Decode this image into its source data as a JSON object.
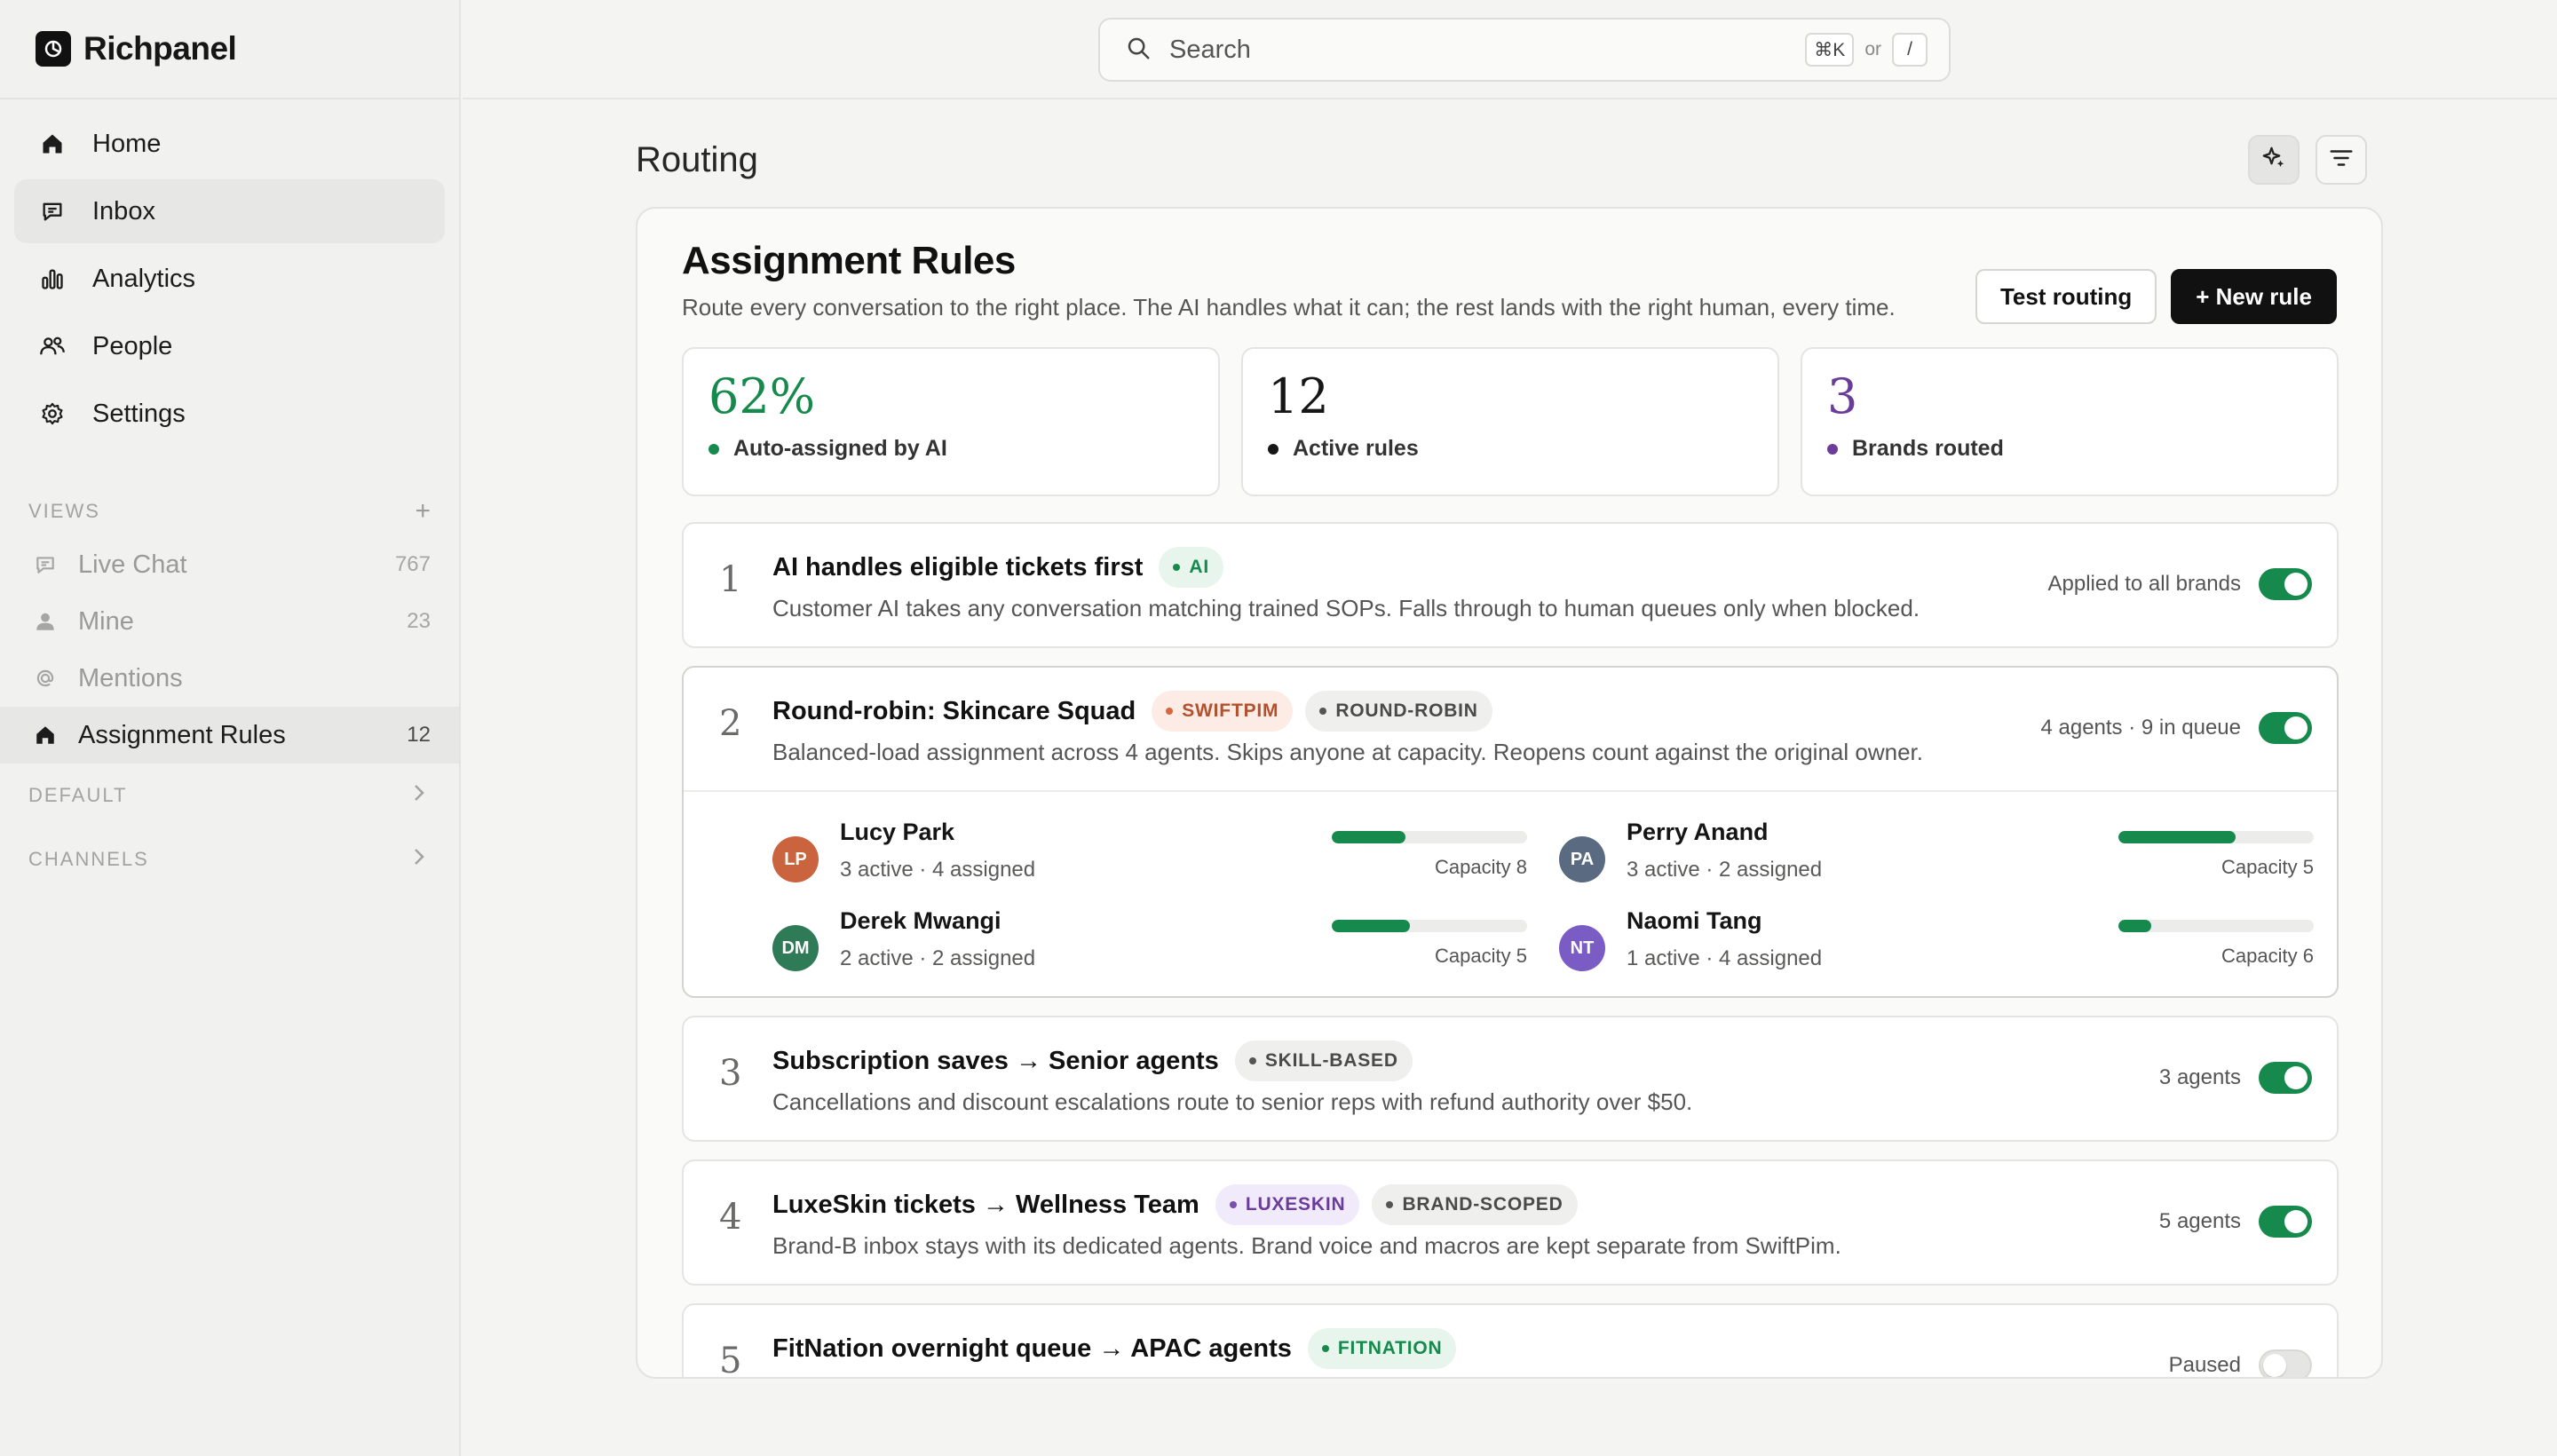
{
  "brand": {
    "name": "Richpanel"
  },
  "nav": [
    {
      "label": "Home",
      "icon": "home-icon"
    },
    {
      "label": "Inbox",
      "icon": "chat-bubble-icon",
      "active": true
    },
    {
      "label": "Analytics",
      "icon": "bar-chart-icon"
    },
    {
      "label": "People",
      "icon": "people-icon"
    },
    {
      "label": "Settings",
      "icon": "gear-icon"
    }
  ],
  "views": {
    "header": "VIEWS",
    "add": "+",
    "items": [
      {
        "label": "Live Chat",
        "count": "767",
        "icon": "chat-bubble-icon"
      },
      {
        "label": "Mine",
        "count": "23",
        "icon": "person-icon"
      },
      {
        "label": "Mentions",
        "count": "",
        "icon": "at-icon"
      },
      {
        "label": "Assignment Rules",
        "count": "12",
        "icon": "home-icon",
        "active": true
      }
    ]
  },
  "sections": [
    {
      "label": "DEFAULT"
    },
    {
      "label": "CHANNELS"
    }
  ],
  "search": {
    "placeholder": "Search",
    "shortcut1": "⌘K",
    "or": "or",
    "shortcut2": "/"
  },
  "page": {
    "title": "Routing"
  },
  "panel": {
    "title": "Assignment Rules",
    "subtitle": "Route every conversation to the right place. The AI handles what it can; the rest lands with the right human, every time.",
    "test_button": "Test routing",
    "new_button": "+ New rule"
  },
  "stats": [
    {
      "value": "62%",
      "label": "Auto-assigned by AI",
      "color": "#16894d",
      "dot": "#16894d"
    },
    {
      "value": "12",
      "label": "Active rules",
      "color": "#161616",
      "dot": "#161616"
    },
    {
      "value": "3",
      "label": "Brands routed",
      "color": "#6a3d9a",
      "dot": "#6a3d9a"
    }
  ],
  "rules": [
    {
      "num": "1",
      "title": "AI handles eligible tickets first",
      "desc": "Customer AI takes any conversation matching trained SOPs. Falls through to human queues only when blocked.",
      "meta": "Applied to all brands",
      "enabled": true,
      "tags": [
        {
          "label": "AI",
          "bg": "#e7f5ec",
          "fg": "#16894d",
          "dot": "#16894d"
        }
      ]
    },
    {
      "num": "2",
      "title": "Round-robin: Skincare Squad",
      "desc": "Balanced-load assignment across 4 agents. Skips anyone at capacity. Reopens count against the original owner.",
      "meta": "4 agents · 9 in queue",
      "enabled": true,
      "tags": [
        {
          "label": "SWIFTPIM",
          "bg": "#fdecE6",
          "fg": "#b4502c",
          "dot": "#d9673c"
        },
        {
          "label": "ROUND-ROBIN",
          "bg": "#efefed",
          "fg": "#4a4a48",
          "dot": "#555553"
        }
      ],
      "agents": [
        {
          "initials": "LP",
          "name": "Lucy Park",
          "stats": "3 active · 4 assigned",
          "capacity": "Capacity 8",
          "load": 0.375,
          "color": "#c9643f"
        },
        {
          "initials": "PA",
          "name": "Perry Anand",
          "stats": "3 active · 2 assigned",
          "capacity": "Capacity 5",
          "load": 0.6,
          "color": "#5a6a80"
        },
        {
          "initials": "DM",
          "name": "Derek Mwangi",
          "stats": "2 active · 2 assigned",
          "capacity": "Capacity 5",
          "load": 0.4,
          "color": "#2f7a57"
        },
        {
          "initials": "NT",
          "name": "Naomi Tang",
          "stats": "1 active · 4 assigned",
          "capacity": "Capacity 6",
          "load": 0.167,
          "color": "#7a5cc4"
        }
      ]
    },
    {
      "num": "3",
      "title": "Subscription saves → Senior agents",
      "desc": "Cancellations and discount escalations route to senior reps with refund authority over $50.",
      "meta": "3 agents",
      "enabled": true,
      "tags": [
        {
          "label": "SKILL-BASED",
          "bg": "#efefed",
          "fg": "#4a4a48",
          "dot": "#555553"
        }
      ]
    },
    {
      "num": "4",
      "title": "LuxeSkin tickets → Wellness Team",
      "desc": "Brand-B inbox stays with its dedicated agents. Brand voice and macros are kept separate from SwiftPim.",
      "meta": "5 agents",
      "enabled": true,
      "tags": [
        {
          "label": "LUXESKIN",
          "bg": "#f1eafa",
          "fg": "#6a3d9a",
          "dot": "#7a4fb0"
        },
        {
          "label": "BRAND-SCOPED",
          "bg": "#efefed",
          "fg": "#4a4a48",
          "dot": "#555553"
        }
      ]
    },
    {
      "num": "5",
      "title": "FitNation overnight queue → APAC agents",
      "desc": "",
      "meta": "Paused",
      "enabled": false,
      "tags": [
        {
          "label": "FITNATION",
          "bg": "#e7f5ec",
          "fg": "#16894d",
          "dot": "#16894d"
        }
      ]
    }
  ]
}
